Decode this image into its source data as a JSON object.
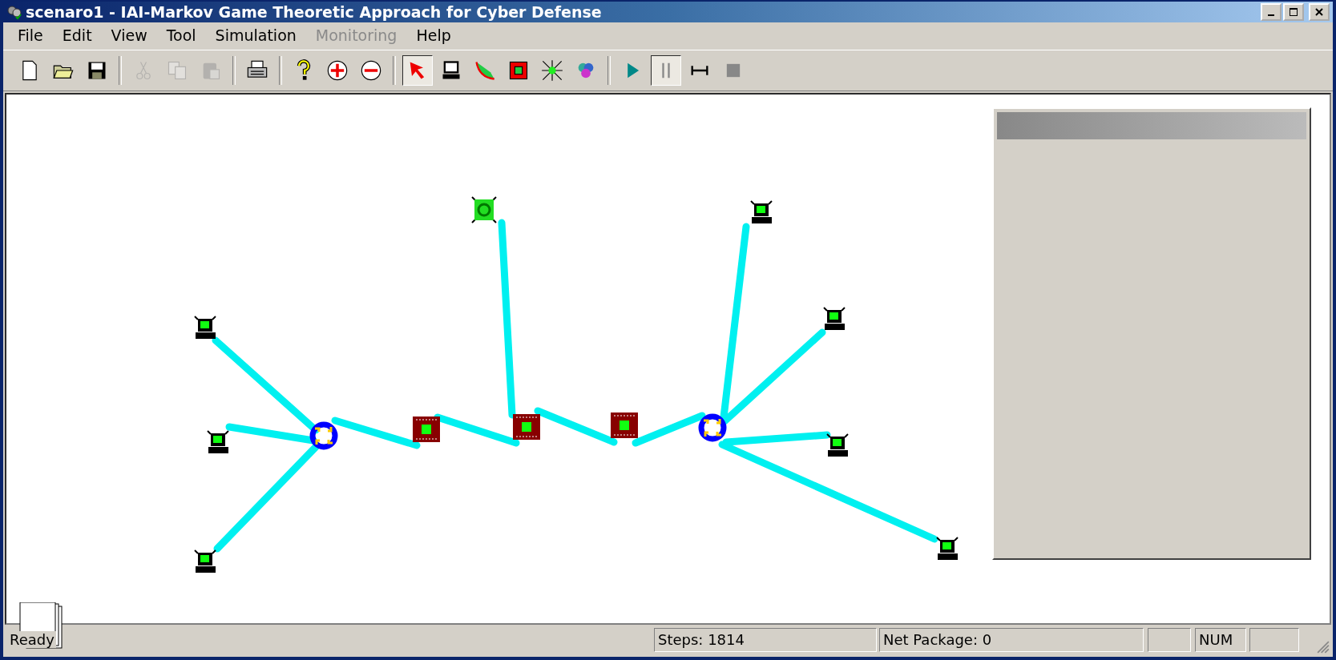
{
  "window": {
    "title": "scenaro1 - IAI-Markov Game Theoretic Approach for Cyber Defense"
  },
  "menu": [
    {
      "label": "File",
      "disabled": false
    },
    {
      "label": "Edit",
      "disabled": false
    },
    {
      "label": "View",
      "disabled": false
    },
    {
      "label": "Tool",
      "disabled": false
    },
    {
      "label": "Simulation",
      "disabled": false
    },
    {
      "label": "Monitoring",
      "disabled": true
    },
    {
      "label": "Help",
      "disabled": false
    }
  ],
  "toolbar": [
    {
      "kind": "new",
      "disabled": false,
      "selected": false
    },
    {
      "kind": "open",
      "disabled": false,
      "selected": false
    },
    {
      "kind": "save",
      "disabled": false,
      "selected": false
    },
    {
      "kind": "separator"
    },
    {
      "kind": "cut",
      "disabled": true,
      "selected": false
    },
    {
      "kind": "copy",
      "disabled": true,
      "selected": false
    },
    {
      "kind": "paste",
      "disabled": true,
      "selected": false
    },
    {
      "kind": "separator"
    },
    {
      "kind": "print",
      "disabled": false,
      "selected": false
    },
    {
      "kind": "separator"
    },
    {
      "kind": "help",
      "disabled": false,
      "selected": false
    },
    {
      "kind": "zoom-in",
      "disabled": false,
      "selected": false
    },
    {
      "kind": "zoom-out",
      "disabled": false,
      "selected": false
    },
    {
      "kind": "separator"
    },
    {
      "kind": "select",
      "disabled": false,
      "selected": true
    },
    {
      "kind": "computer",
      "disabled": false,
      "selected": false
    },
    {
      "kind": "link",
      "disabled": false,
      "selected": false
    },
    {
      "kind": "router",
      "disabled": false,
      "selected": false
    },
    {
      "kind": "hub",
      "disabled": false,
      "selected": false
    },
    {
      "kind": "group",
      "disabled": false,
      "selected": false
    },
    {
      "kind": "separator"
    },
    {
      "kind": "play",
      "disabled": false,
      "selected": false
    },
    {
      "kind": "pause",
      "disabled": false,
      "selected": true
    },
    {
      "kind": "step",
      "disabled": false,
      "selected": false
    },
    {
      "kind": "stop",
      "disabled": false,
      "selected": false
    }
  ],
  "status_bar": {
    "message": "Ready",
    "steps": "Steps: 1814",
    "net_package": "Net Package: 0",
    "num": "NUM"
  }
}
